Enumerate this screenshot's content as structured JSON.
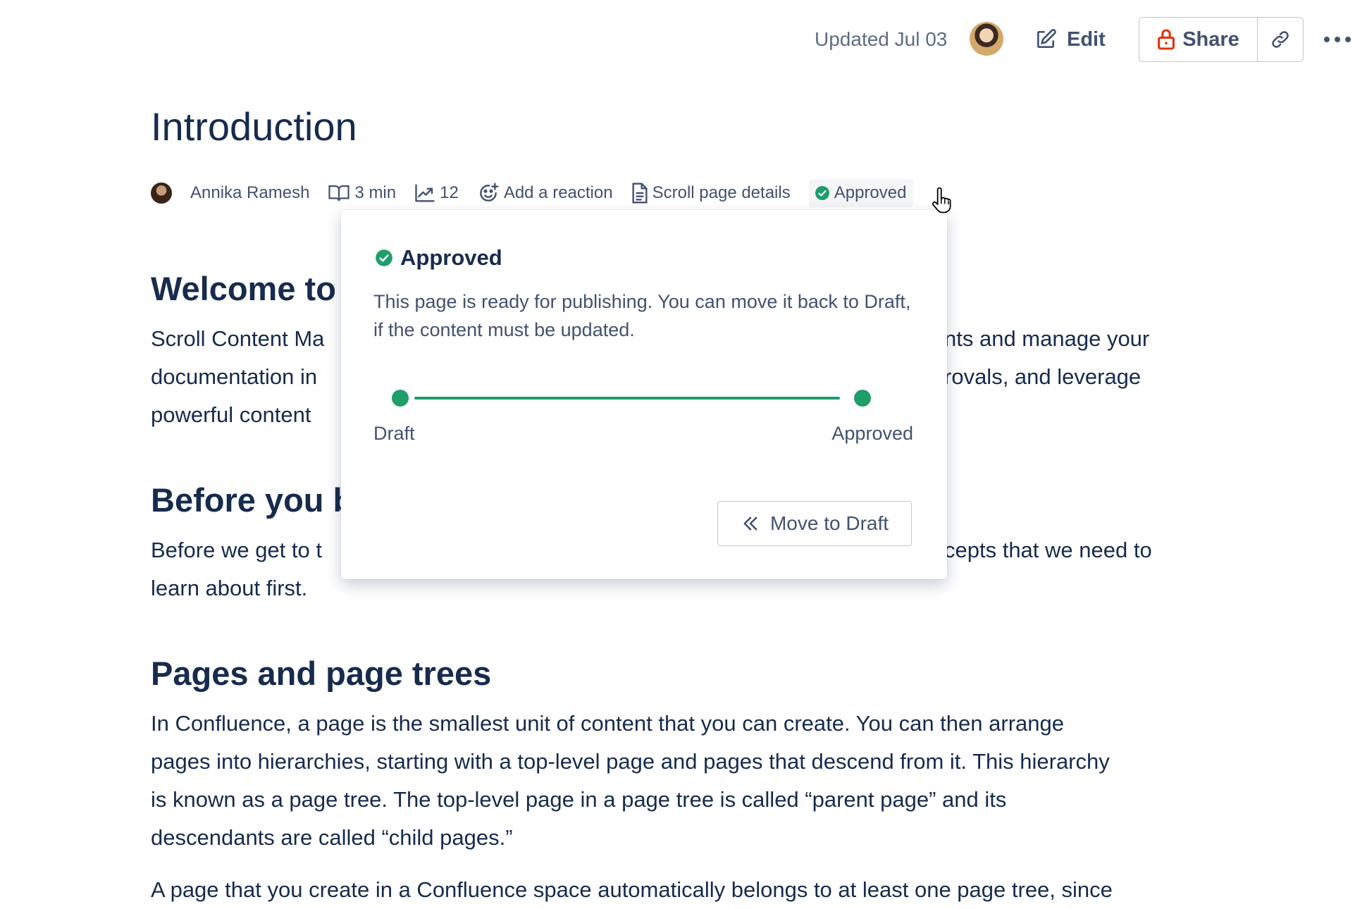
{
  "topbar": {
    "updated": "Updated Jul 03",
    "edit_label": "Edit",
    "share_label": "Share"
  },
  "page": {
    "title": "Introduction"
  },
  "byline": {
    "author": "Annika Ramesh",
    "read_time": "3 min",
    "views": "12",
    "reaction_label": "Add a reaction",
    "details_label": "Scroll page details",
    "status_label": "Approved"
  },
  "content": {
    "welcome_heading": "Welcome to",
    "welcome_lines": [
      "Scroll Content Ma",
      "documentation in",
      "powerful content"
    ],
    "welcome_right_lines": [
      "nts and manage your",
      "rovals, and leverage"
    ],
    "before_heading": "Before you b",
    "before_lines": [
      "Before we get to t",
      "learn about first."
    ],
    "before_right": "cepts that we need to",
    "pages_heading": "Pages and page trees",
    "pages_lines": [
      "In Confluence, a page is the smallest unit of content that you can create. You can then arrange",
      "pages into hierarchies, starting with a top-level page and pages that descend from it. This hierarchy",
      "is known as a page tree. The top-level page in a page tree is called “parent page” and its",
      "descendants are called “child pages.”"
    ],
    "last_line": "A page that you create in a Confluence space automatically belongs to at least one page tree, since"
  },
  "popover": {
    "title": "Approved",
    "description": "This page is ready for publishing. You can move it back to Draft, if the content must be updated.",
    "step_start": "Draft",
    "step_end": "Approved",
    "move_label": "Move to Draft"
  },
  "colors": {
    "text": "#172B4D",
    "subtle": "#42526E",
    "success": "#1F9D6B",
    "danger": "#DE350B"
  }
}
